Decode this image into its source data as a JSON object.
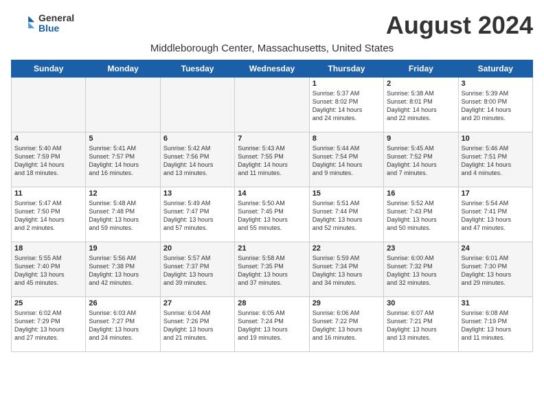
{
  "header": {
    "logo_general": "General",
    "logo_blue": "Blue",
    "month_title": "August 2024",
    "subtitle": "Middleborough Center, Massachusetts, United States"
  },
  "days_of_week": [
    "Sunday",
    "Monday",
    "Tuesday",
    "Wednesday",
    "Thursday",
    "Friday",
    "Saturday"
  ],
  "weeks": [
    [
      {
        "day": "",
        "info": ""
      },
      {
        "day": "",
        "info": ""
      },
      {
        "day": "",
        "info": ""
      },
      {
        "day": "",
        "info": ""
      },
      {
        "day": "1",
        "info": "Sunrise: 5:37 AM\nSunset: 8:02 PM\nDaylight: 14 hours\nand 24 minutes."
      },
      {
        "day": "2",
        "info": "Sunrise: 5:38 AM\nSunset: 8:01 PM\nDaylight: 14 hours\nand 22 minutes."
      },
      {
        "day": "3",
        "info": "Sunrise: 5:39 AM\nSunset: 8:00 PM\nDaylight: 14 hours\nand 20 minutes."
      }
    ],
    [
      {
        "day": "4",
        "info": "Sunrise: 5:40 AM\nSunset: 7:59 PM\nDaylight: 14 hours\nand 18 minutes."
      },
      {
        "day": "5",
        "info": "Sunrise: 5:41 AM\nSunset: 7:57 PM\nDaylight: 14 hours\nand 16 minutes."
      },
      {
        "day": "6",
        "info": "Sunrise: 5:42 AM\nSunset: 7:56 PM\nDaylight: 14 hours\nand 13 minutes."
      },
      {
        "day": "7",
        "info": "Sunrise: 5:43 AM\nSunset: 7:55 PM\nDaylight: 14 hours\nand 11 minutes."
      },
      {
        "day": "8",
        "info": "Sunrise: 5:44 AM\nSunset: 7:54 PM\nDaylight: 14 hours\nand 9 minutes."
      },
      {
        "day": "9",
        "info": "Sunrise: 5:45 AM\nSunset: 7:52 PM\nDaylight: 14 hours\nand 7 minutes."
      },
      {
        "day": "10",
        "info": "Sunrise: 5:46 AM\nSunset: 7:51 PM\nDaylight: 14 hours\nand 4 minutes."
      }
    ],
    [
      {
        "day": "11",
        "info": "Sunrise: 5:47 AM\nSunset: 7:50 PM\nDaylight: 14 hours\nand 2 minutes."
      },
      {
        "day": "12",
        "info": "Sunrise: 5:48 AM\nSunset: 7:48 PM\nDaylight: 13 hours\nand 59 minutes."
      },
      {
        "day": "13",
        "info": "Sunrise: 5:49 AM\nSunset: 7:47 PM\nDaylight: 13 hours\nand 57 minutes."
      },
      {
        "day": "14",
        "info": "Sunrise: 5:50 AM\nSunset: 7:45 PM\nDaylight: 13 hours\nand 55 minutes."
      },
      {
        "day": "15",
        "info": "Sunrise: 5:51 AM\nSunset: 7:44 PM\nDaylight: 13 hours\nand 52 minutes."
      },
      {
        "day": "16",
        "info": "Sunrise: 5:52 AM\nSunset: 7:43 PM\nDaylight: 13 hours\nand 50 minutes."
      },
      {
        "day": "17",
        "info": "Sunrise: 5:54 AM\nSunset: 7:41 PM\nDaylight: 13 hours\nand 47 minutes."
      }
    ],
    [
      {
        "day": "18",
        "info": "Sunrise: 5:55 AM\nSunset: 7:40 PM\nDaylight: 13 hours\nand 45 minutes."
      },
      {
        "day": "19",
        "info": "Sunrise: 5:56 AM\nSunset: 7:38 PM\nDaylight: 13 hours\nand 42 minutes."
      },
      {
        "day": "20",
        "info": "Sunrise: 5:57 AM\nSunset: 7:37 PM\nDaylight: 13 hours\nand 39 minutes."
      },
      {
        "day": "21",
        "info": "Sunrise: 5:58 AM\nSunset: 7:35 PM\nDaylight: 13 hours\nand 37 minutes."
      },
      {
        "day": "22",
        "info": "Sunrise: 5:59 AM\nSunset: 7:34 PM\nDaylight: 13 hours\nand 34 minutes."
      },
      {
        "day": "23",
        "info": "Sunrise: 6:00 AM\nSunset: 7:32 PM\nDaylight: 13 hours\nand 32 minutes."
      },
      {
        "day": "24",
        "info": "Sunrise: 6:01 AM\nSunset: 7:30 PM\nDaylight: 13 hours\nand 29 minutes."
      }
    ],
    [
      {
        "day": "25",
        "info": "Sunrise: 6:02 AM\nSunset: 7:29 PM\nDaylight: 13 hours\nand 27 minutes."
      },
      {
        "day": "26",
        "info": "Sunrise: 6:03 AM\nSunset: 7:27 PM\nDaylight: 13 hours\nand 24 minutes."
      },
      {
        "day": "27",
        "info": "Sunrise: 6:04 AM\nSunset: 7:26 PM\nDaylight: 13 hours\nand 21 minutes."
      },
      {
        "day": "28",
        "info": "Sunrise: 6:05 AM\nSunset: 7:24 PM\nDaylight: 13 hours\nand 19 minutes."
      },
      {
        "day": "29",
        "info": "Sunrise: 6:06 AM\nSunset: 7:22 PM\nDaylight: 13 hours\nand 16 minutes."
      },
      {
        "day": "30",
        "info": "Sunrise: 6:07 AM\nSunset: 7:21 PM\nDaylight: 13 hours\nand 13 minutes."
      },
      {
        "day": "31",
        "info": "Sunrise: 6:08 AM\nSunset: 7:19 PM\nDaylight: 13 hours\nand 11 minutes."
      }
    ]
  ]
}
